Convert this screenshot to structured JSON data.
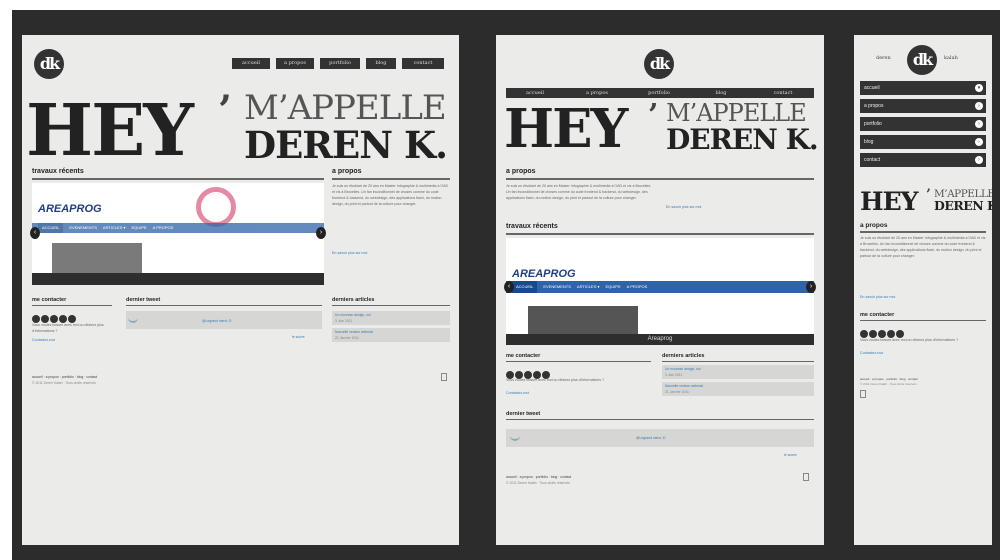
{
  "logo": {
    "text": "dk"
  },
  "nav": [
    "accueil",
    "a propos",
    "portfolio",
    "blog",
    "contact"
  ],
  "hero": {
    "hey": "HEY",
    "apos": "’",
    "mappelle": "M’APPELLE",
    "name": "DEREN K."
  },
  "sections": {
    "travaux": "travaux récents",
    "apropos": "a propos",
    "contacter": "me contacter",
    "tweet": "dernier tweet",
    "articles": "derniers articles"
  },
  "apropos_text": "Je suis un étudiant de 20 ans en Master Infographie & multimédia à l’IAD et vis à Bruxelles. Un fan inconditionnel de choses comme du code frontend & backend, du webdesign, des applications flash, du motion design, du print et partout de la culture pour changer.",
  "apropos_link": "En savoir plus sur moi",
  "slider": {
    "brand": "AREAPROG",
    "items": [
      "ACCUEIL",
      "EVENEMENTS",
      "ARTICLES ▾",
      "EQUIPE",
      "A PROPOS"
    ],
    "caption": "Areaprog"
  },
  "contact_text": "Vous voulez bosser avec moi ou désirez plus d’informations ?",
  "contact_link": "Contactez-moi",
  "tweet_text": "@Legrand merci :D",
  "tweet_more": "le suivre",
  "articles": [
    {
      "title": "Un nouveau design, oui",
      "date": "3 Juin 2011"
    },
    {
      "title": "Nouvelle version webnick",
      "date": "21 Janvier 2011"
    }
  ],
  "footer": {
    "links": "accueil · a propos · portfolio · blog · contact",
    "copy": "© 2011 Deren Kalah · Tous droits réservés"
  },
  "mobile": {
    "first": "deren",
    "last": "kalah"
  }
}
